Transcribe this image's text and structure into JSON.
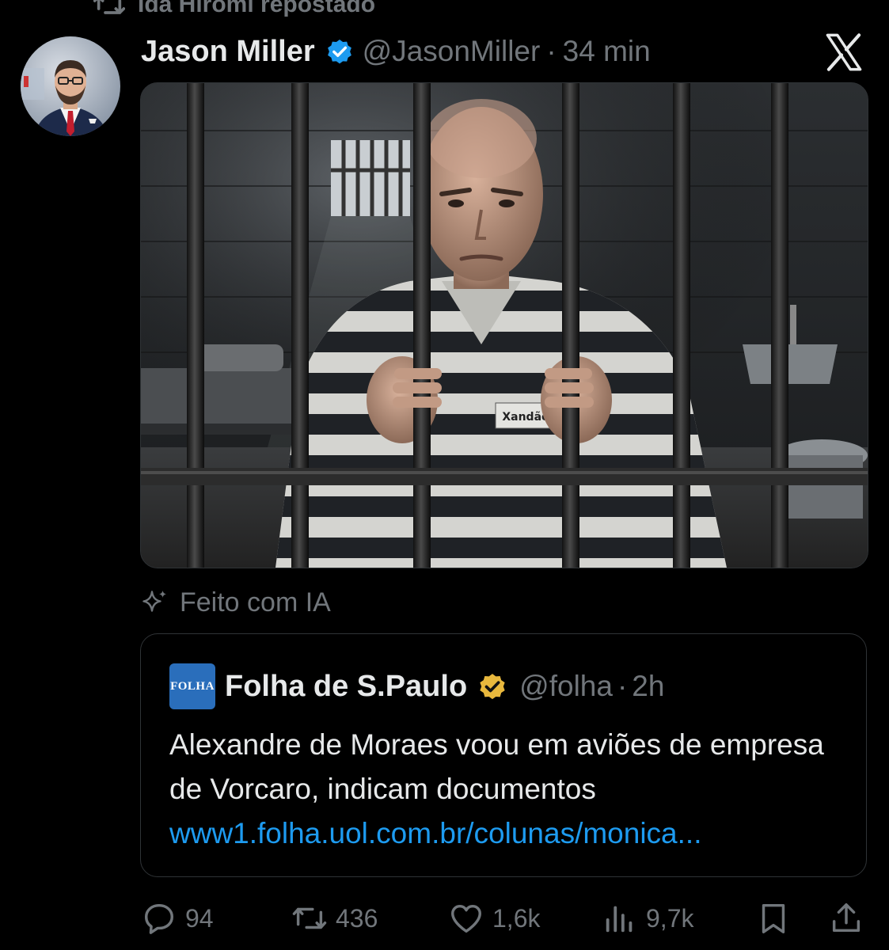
{
  "repost": {
    "text": "Ida Hiromi repostado",
    "icon": "repost-icon"
  },
  "post": {
    "author_name": "Jason Miller",
    "handle": "@JasonMiller",
    "separator": "·",
    "time": "34 min",
    "verified_color": "#1d9bf0",
    "image_label": "Xandão",
    "ai_label": "Feito com IA"
  },
  "quote": {
    "logo_text": "FOLHA",
    "author_name": "Folha de S.Paulo",
    "handle": "@folha",
    "separator": "·",
    "time": "2h",
    "verified_color": "#e8b83d",
    "text": "Alexandre de Moraes voou em aviões de empresa de Vorcaro, indicam documentos",
    "link": "www1.folha.uol.com.br/colunas/monica..."
  },
  "actions": {
    "replies": "94",
    "reposts": "436",
    "likes": "1,6k",
    "views": "9,7k"
  },
  "colors": {
    "background": "#000000",
    "text": "#e7e9ea",
    "muted": "#71767b",
    "link": "#1d9bf0",
    "border": "#2f3336"
  }
}
